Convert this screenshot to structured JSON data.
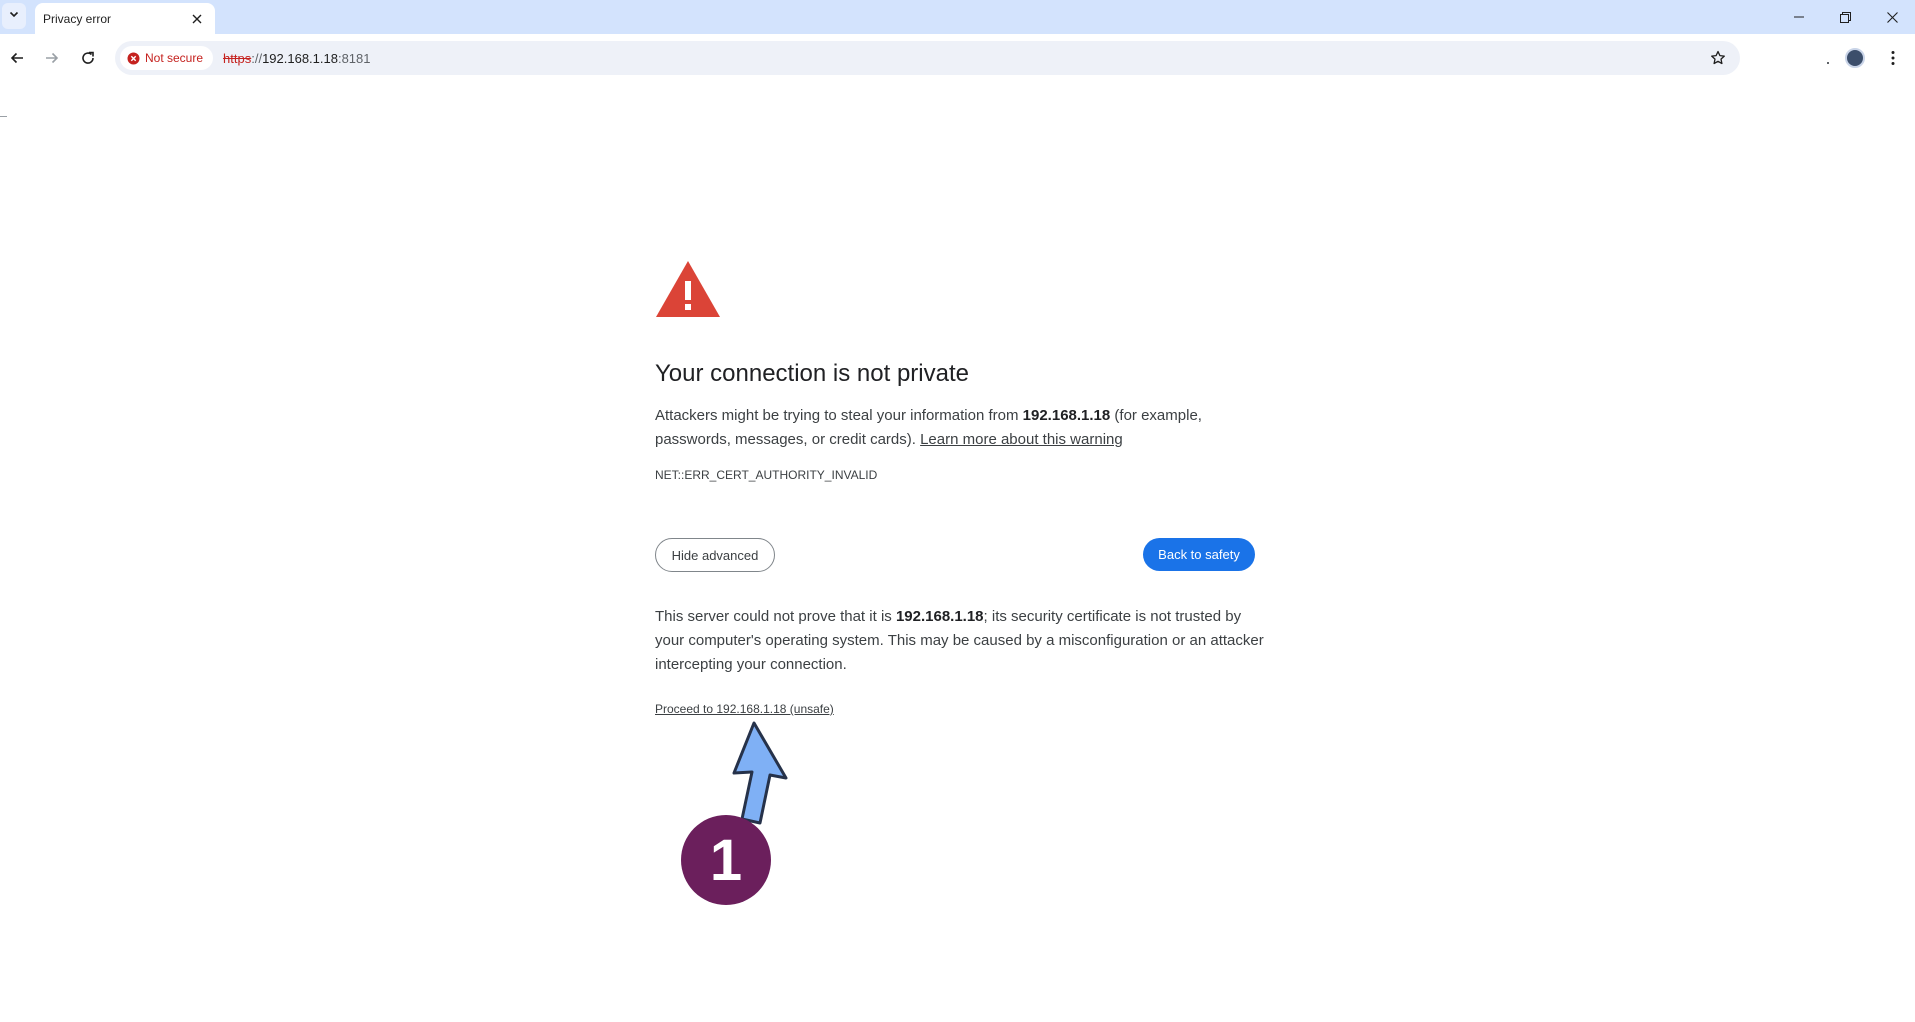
{
  "browser": {
    "tab": {
      "title": "Privacy error"
    },
    "address_bar": {
      "security_label": "Not secure",
      "url_scheme": "https",
      "url_separator": "://",
      "url_host": "192.168.1.18",
      "url_port": ":8181"
    }
  },
  "interstitial": {
    "heading": "Your connection is not private",
    "body_prefix": "Attackers might be trying to steal your information from ",
    "body_host": "192.168.1.18",
    "body_suffix": " (for example, passwords, messages, or credit cards). ",
    "learn_more_link": "Learn more about this warning",
    "error_code": "NET::ERR_CERT_AUTHORITY_INVALID",
    "hide_advanced_label": "Hide advanced",
    "back_to_safety_label": "Back to safety",
    "details_prefix": "This server could not prove that it is ",
    "details_host": "192.168.1.18",
    "details_suffix": "; its security certificate is not trusted by your computer's operating system. This may be caused by a misconfiguration or an attacker intercepting your connection.",
    "proceed_link": "Proceed to 192.168.1.18 (unsafe)"
  },
  "annotation": {
    "step_number": "1",
    "arrow_color": "#7fb0f5",
    "badge_color": "#6b1f5c"
  },
  "colors": {
    "tabstrip": "#d3e3fd",
    "primary_button": "#1a73e8",
    "warning_red": "#db4437",
    "not_secure_red": "#c5221f"
  },
  "icons": {
    "tab_search": "chevron-down-icon",
    "tab_close": "close-icon",
    "minimize": "minimize-icon",
    "restore": "restore-icon",
    "close_window": "close-icon",
    "back": "arrow-left-icon",
    "forward": "arrow-right-icon",
    "reload": "reload-icon",
    "not_secure": "error-circle-icon",
    "bookmark": "star-outline-icon",
    "menu": "kebab-menu-icon",
    "warning": "warning-triangle-icon"
  }
}
